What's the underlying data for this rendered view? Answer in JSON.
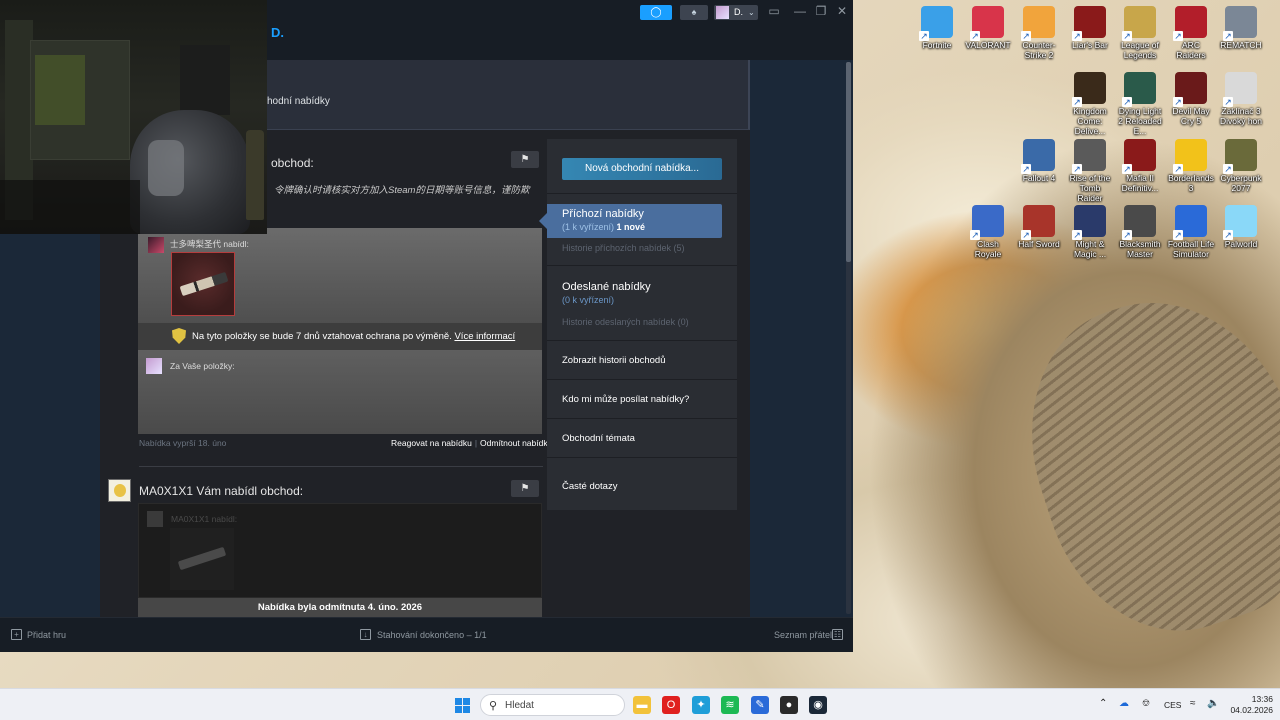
{
  "desktop": {
    "icons": [
      {
        "label": "Fortnite",
        "color": "#3aa0e8"
      },
      {
        "label": "VALORANT",
        "color": "#d8344a"
      },
      {
        "label": "Counter-Strike 2",
        "color": "#f1a43c"
      },
      {
        "label": "Liar's Bar",
        "color": "#8a1a1a"
      },
      {
        "label": "League of Legends",
        "color": "#c8a64a"
      },
      {
        "label": "ARC Raiders",
        "color": "#b21e2a"
      },
      {
        "label": "REMATCH",
        "color": "#7b8796"
      },
      {
        "label": "Kingdom Come: Delive...",
        "color": "#3a2a1a"
      },
      {
        "label": "Dying Light 2 Reloaded E...",
        "color": "#2a5a4a"
      },
      {
        "label": "Devil May Cry 5",
        "color": "#6a1a1a"
      },
      {
        "label": "Zaklínač 3 Divoký hon",
        "color": "#d9d9d9"
      },
      {
        "label": "Fallout 4",
        "color": "#3a6aa8"
      },
      {
        "label": "Rise of the Tomb Raider",
        "color": "#5a5a5a"
      },
      {
        "label": "Mafia II Definitiv...",
        "color": "#8a1a1a"
      },
      {
        "label": "Borderlands 3",
        "color": "#f2c21a"
      },
      {
        "label": "Cyberpunk 2077",
        "color": "#6a6a3a"
      },
      {
        "label": "Clash Royale",
        "color": "#3a6ac8"
      },
      {
        "label": "Half Sword",
        "color": "#a8342a"
      },
      {
        "label": "Might & Magic ...",
        "color": "#2a3a6a"
      },
      {
        "label": "Blacksmith Master",
        "color": "#4a4a4a"
      },
      {
        "label": "Football Life Simulator",
        "color": "#2a6ad8"
      },
      {
        "label": "Palworld",
        "color": "#8ad8f8"
      }
    ]
  },
  "steam": {
    "titlebar": {
      "user_name": "D.",
      "brand_fragment": "D.",
      "notify_icon": "megaphone-icon",
      "bell_icon": "bell-icon",
      "window_buttons": [
        "▭",
        "—",
        "❐",
        "✕"
      ]
    },
    "header": {
      "title_fragment": "chodní nabídky"
    },
    "offer1": {
      "title_fragment": "obchod:",
      "message": "令牌确认时请核实对方加入Steam的日期等账号信息，谨防欺",
      "they_offered": "士多啤梨圣代 nabídl:",
      "protection_text": "Na tyto položky se bude 7 dnů vztahovat ochrana po výměně.",
      "protection_link": "Více informací",
      "for_your_items": "Za Vaše položky:",
      "expiry": "Nabídka vyprší 18. úno",
      "respond": "Reagovat na nabídku",
      "decline": "Odmítnout nabídku"
    },
    "offer2": {
      "title": "MA0X1X1 Vám nabídl obchod:",
      "they_offered": "MA0X1X1 nabídl:",
      "declined": "Nabídka byla odmítnuta 4. úno. 2026"
    },
    "sidebar": {
      "new_offer": "Nová obchodní nabídka...",
      "incoming_title": "Příchozí nabídky",
      "incoming_pending": "(1 k vyřízení)",
      "incoming_new": "1 nové",
      "incoming_history": "Historie příchozích nabídek (5)",
      "sent_title": "Odeslané nabídky",
      "sent_pending": "(0 k vyřízení)",
      "sent_history": "Historie odeslaných nabídek (0)",
      "trade_history": "Zobrazit historii obchodů",
      "who_can_send": "Kdo mi může posílat nabídky?",
      "topics": "Obchodní témata",
      "faq": "Časté dotazy"
    },
    "footer": {
      "add_game": "Přidat hru",
      "downloads": "Stahování dokončeno – 1/1",
      "friends": "Seznam přátel"
    }
  },
  "taskbar": {
    "search_placeholder": "Hledat",
    "apps": [
      {
        "name": "file-explorer-icon",
        "color": "#f2c23a",
        "glyph": "▬"
      },
      {
        "name": "opera-icon",
        "color": "#e0201e",
        "glyph": "O"
      },
      {
        "name": "kodi-icon",
        "color": "#1f9ed8",
        "glyph": "✦"
      },
      {
        "name": "spotify-icon",
        "color": "#1db954",
        "glyph": "≋"
      },
      {
        "name": "notes-app-icon",
        "color": "#2a6ad8",
        "glyph": "✎"
      },
      {
        "name": "game-app-icon",
        "color": "#2a2a2a",
        "glyph": "●"
      },
      {
        "name": "steam-icon",
        "color": "#1b2838",
        "glyph": "◉"
      }
    ],
    "tray": {
      "language": "CES"
    },
    "clock": {
      "time": "13:36",
      "date": "04.02.2026"
    }
  }
}
